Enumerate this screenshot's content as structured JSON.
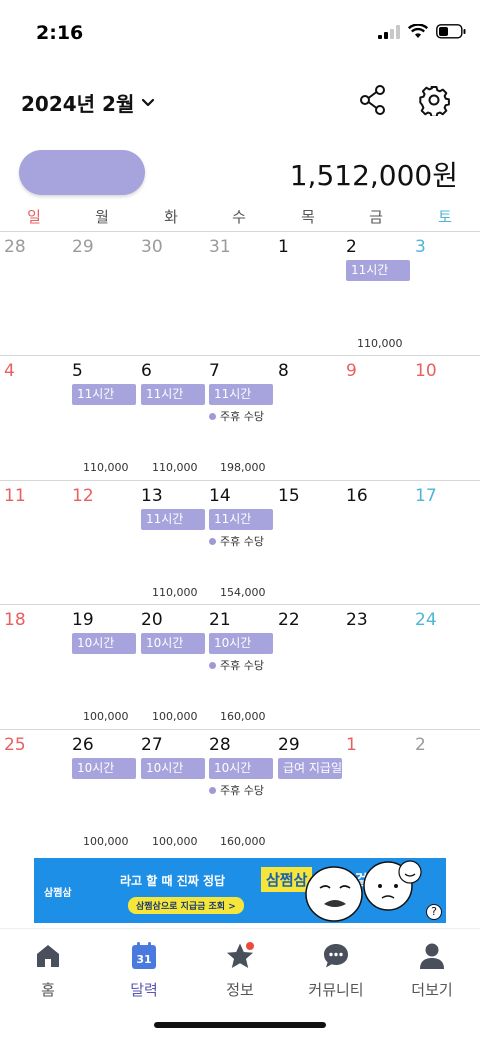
{
  "status": {
    "time": "2:16"
  },
  "header": {
    "title": "2024년 2월",
    "share_icon": "share-icon",
    "settings_icon": "gear-icon"
  },
  "summary": {
    "total": "1,512,000원"
  },
  "colors": {
    "accent": "#a7a3dc",
    "sunday": "#e8605f",
    "saturday": "#4fb5d6",
    "other_month": "#9a9a9a",
    "ad_blue": "#1e8fe6",
    "ad_yellow": "#f6e63b"
  },
  "weekdays": [
    "일",
    "월",
    "화",
    "수",
    "목",
    "금",
    "토"
  ],
  "weeks": [
    {
      "days": [
        {
          "num": "28",
          "kind": "other"
        },
        {
          "num": "29",
          "kind": "other"
        },
        {
          "num": "30",
          "kind": "other"
        },
        {
          "num": "31",
          "kind": "other"
        },
        {
          "num": "1",
          "kind": "normal"
        },
        {
          "num": "2",
          "kind": "normal",
          "tag": "11시간",
          "amount": "110,000"
        },
        {
          "num": "3",
          "kind": "sat"
        }
      ]
    },
    {
      "days": [
        {
          "num": "4",
          "kind": "sun"
        },
        {
          "num": "5",
          "kind": "normal",
          "tag": "11시간",
          "amount": "110,000"
        },
        {
          "num": "6",
          "kind": "normal",
          "tag": "11시간",
          "amount": "110,000"
        },
        {
          "num": "7",
          "kind": "normal",
          "tag": "11시간",
          "note": "주휴 수당",
          "amount": "198,000"
        },
        {
          "num": "8",
          "kind": "normal"
        },
        {
          "num": "9",
          "kind": "sun"
        },
        {
          "num": "10",
          "kind": "sun"
        }
      ]
    },
    {
      "days": [
        {
          "num": "11",
          "kind": "sun"
        },
        {
          "num": "12",
          "kind": "sun"
        },
        {
          "num": "13",
          "kind": "normal",
          "tag": "11시간",
          "amount": "110,000"
        },
        {
          "num": "14",
          "kind": "normal",
          "tag": "11시간",
          "note": "주휴 수당",
          "amount": "154,000"
        },
        {
          "num": "15",
          "kind": "normal"
        },
        {
          "num": "16",
          "kind": "normal"
        },
        {
          "num": "17",
          "kind": "sat"
        }
      ]
    },
    {
      "days": [
        {
          "num": "18",
          "kind": "sun"
        },
        {
          "num": "19",
          "kind": "normal",
          "tag": "10시간",
          "amount": "100,000"
        },
        {
          "num": "20",
          "kind": "normal",
          "tag": "10시간",
          "amount": "100,000"
        },
        {
          "num": "21",
          "kind": "normal",
          "tag": "10시간",
          "note": "주휴 수당",
          "amount": "160,000"
        },
        {
          "num": "22",
          "kind": "normal"
        },
        {
          "num": "23",
          "kind": "normal"
        },
        {
          "num": "24",
          "kind": "sat"
        }
      ]
    },
    {
      "days": [
        {
          "num": "25",
          "kind": "sun"
        },
        {
          "num": "26",
          "kind": "normal",
          "tag": "10시간",
          "amount": "100,000"
        },
        {
          "num": "27",
          "kind": "normal",
          "tag": "10시간",
          "amount": "100,000"
        },
        {
          "num": "28",
          "kind": "normal",
          "tag": "10시간",
          "note": "주휴 수당",
          "amount": "160,000"
        },
        {
          "num": "29",
          "kind": "normal",
          "tag": "급여 지급일"
        },
        {
          "num": "1",
          "kind": "sun"
        },
        {
          "num": "2",
          "kind": "other"
        }
      ]
    }
  ],
  "ad": {
    "brand": "삼쩜삼",
    "headline": "라고 할 때 진짜 정답",
    "highlight": "삼쩜삼",
    "tail": "할 걸",
    "cta": "삼쩜삼으로 지급금 조회 >",
    "help": "?"
  },
  "tabs": [
    {
      "label": "홈",
      "icon": "home-icon"
    },
    {
      "label": "달력",
      "icon": "calendar-icon",
      "badge_text": "31",
      "active": true
    },
    {
      "label": "정보",
      "icon": "star-icon",
      "has_dot": true
    },
    {
      "label": "커뮤니티",
      "icon": "chat-icon"
    },
    {
      "label": "더보기",
      "icon": "person-icon"
    }
  ]
}
